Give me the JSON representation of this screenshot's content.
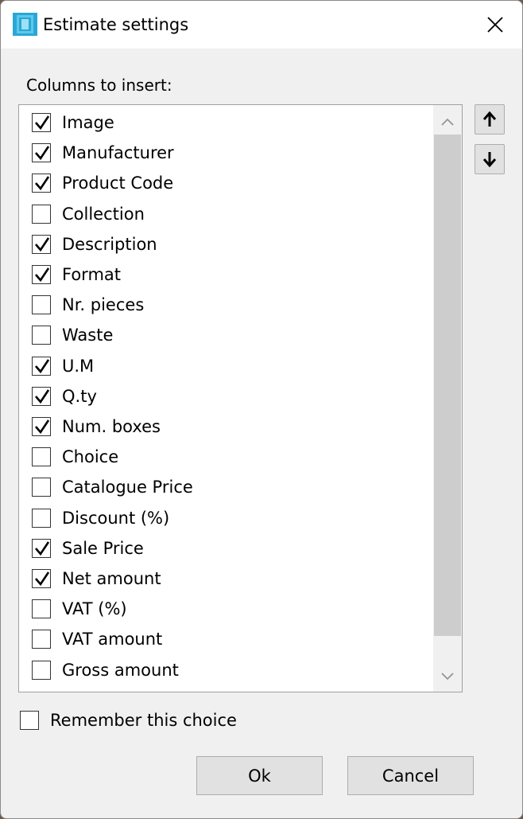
{
  "window": {
    "title": "Estimate settings"
  },
  "section": {
    "label": "Columns to insert:"
  },
  "columns": [
    {
      "label": "Image",
      "checked": true
    },
    {
      "label": "Manufacturer",
      "checked": true
    },
    {
      "label": "Product Code",
      "checked": true
    },
    {
      "label": "Collection",
      "checked": false
    },
    {
      "label": "Description",
      "checked": true
    },
    {
      "label": "Format",
      "checked": true
    },
    {
      "label": "Nr. pieces",
      "checked": false
    },
    {
      "label": "Waste",
      "checked": false
    },
    {
      "label": "U.M",
      "checked": true
    },
    {
      "label": "Q.ty",
      "checked": true
    },
    {
      "label": "Num. boxes",
      "checked": true
    },
    {
      "label": "Choice",
      "checked": false
    },
    {
      "label": "Catalogue Price",
      "checked": false
    },
    {
      "label": "Discount (%)",
      "checked": false
    },
    {
      "label": "Sale Price",
      "checked": true
    },
    {
      "label": "Net amount",
      "checked": true
    },
    {
      "label": "VAT (%)",
      "checked": false
    },
    {
      "label": "VAT amount",
      "checked": false
    },
    {
      "label": "Gross amount",
      "checked": false
    }
  ],
  "remember": {
    "label": "Remember this choice",
    "checked": false
  },
  "buttons": {
    "ok": "Ok",
    "cancel": "Cancel"
  },
  "icons": {
    "app": "app-icon",
    "close": "close-icon",
    "move_up": "arrow-up-icon",
    "move_down": "arrow-down-icon",
    "scroll_up": "chevron-up-icon",
    "scroll_down": "chevron-down-icon",
    "check": "checkmark-icon"
  },
  "colors": {
    "app_icon_accent": "#2aa7d6",
    "dialog_bg": "#f0f0f0",
    "button_bg": "#e1e1e1",
    "scroll_thumb": "#cdcdcd"
  }
}
